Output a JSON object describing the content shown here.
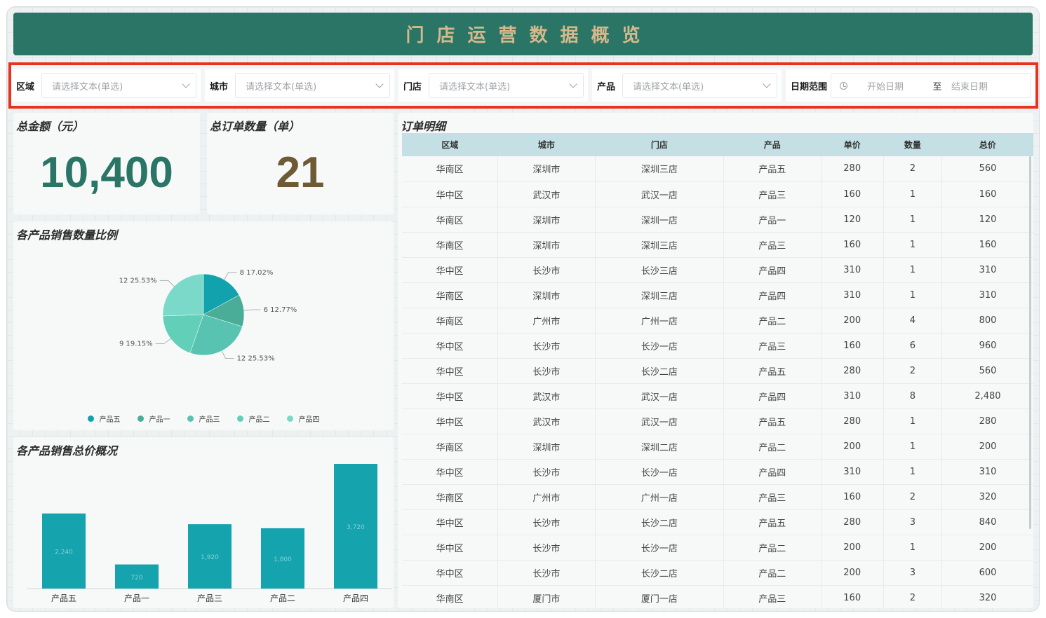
{
  "header": {
    "title": "门店运营数据概览"
  },
  "filters": [
    {
      "label": "区域",
      "placeholder": "请选择文本(单选)"
    },
    {
      "label": "城市",
      "placeholder": "请选择文本(单选)"
    },
    {
      "label": "门店",
      "placeholder": "请选择文本(单选)"
    },
    {
      "label": "产品",
      "placeholder": "请选择文本(单选)"
    }
  ],
  "date_range": {
    "label": "日期范围",
    "start_placeholder": "开始日期",
    "separator": "至",
    "end_placeholder": "结束日期"
  },
  "kpi": {
    "total_amount": {
      "title": "总金额（元）",
      "value": "10,400",
      "color": "#2a7566"
    },
    "total_orders": {
      "title": "总订单数量（单）",
      "value": "21",
      "color": "#6e5a35"
    }
  },
  "pie_card": {
    "title": "各产品销售数量比例"
  },
  "bar_card": {
    "title": "各产品销售总价概况"
  },
  "orders_card": {
    "title": "订单明细"
  },
  "orders": {
    "columns": [
      "区域",
      "城市",
      "门店",
      "产品",
      "单价",
      "数量",
      "总价"
    ],
    "rows": [
      [
        "华南区",
        "深圳市",
        "深圳三店",
        "产品五",
        "280",
        "2",
        "560"
      ],
      [
        "华中区",
        "武汉市",
        "武汉一店",
        "产品三",
        "160",
        "1",
        "160"
      ],
      [
        "华南区",
        "深圳市",
        "深圳一店",
        "产品一",
        "120",
        "1",
        "120"
      ],
      [
        "华南区",
        "深圳市",
        "深圳三店",
        "产品三",
        "160",
        "1",
        "160"
      ],
      [
        "华中区",
        "长沙市",
        "长沙三店",
        "产品四",
        "310",
        "1",
        "310"
      ],
      [
        "华南区",
        "深圳市",
        "深圳三店",
        "产品四",
        "310",
        "1",
        "310"
      ],
      [
        "华南区",
        "广州市",
        "广州一店",
        "产品二",
        "200",
        "4",
        "800"
      ],
      [
        "华中区",
        "长沙市",
        "长沙一店",
        "产品三",
        "160",
        "6",
        "960"
      ],
      [
        "华中区",
        "长沙市",
        "长沙二店",
        "产品五",
        "280",
        "2",
        "560"
      ],
      [
        "华中区",
        "武汉市",
        "武汉一店",
        "产品四",
        "310",
        "8",
        "2,480"
      ],
      [
        "华中区",
        "武汉市",
        "武汉一店",
        "产品五",
        "280",
        "1",
        "280"
      ],
      [
        "华南区",
        "深圳市",
        "深圳二店",
        "产品二",
        "200",
        "1",
        "200"
      ],
      [
        "华中区",
        "长沙市",
        "长沙一店",
        "产品四",
        "310",
        "1",
        "310"
      ],
      [
        "华南区",
        "广州市",
        "广州一店",
        "产品三",
        "160",
        "2",
        "320"
      ],
      [
        "华中区",
        "长沙市",
        "长沙二店",
        "产品五",
        "280",
        "3",
        "840"
      ],
      [
        "华中区",
        "长沙市",
        "长沙一店",
        "产品二",
        "200",
        "1",
        "200"
      ],
      [
        "华中区",
        "长沙市",
        "长沙二店",
        "产品二",
        "200",
        "3",
        "600"
      ],
      [
        "华南区",
        "厦门市",
        "厦门一店",
        "产品三",
        "160",
        "2",
        "320"
      ]
    ]
  },
  "chart_data": [
    {
      "type": "pie",
      "title": "各产品销售数量比例",
      "categories": [
        "产品五",
        "产品一",
        "产品三",
        "产品二",
        "产品四"
      ],
      "values": [
        8,
        6,
        12,
        9,
        12
      ],
      "slice_labels": [
        "8 17.02%",
        "6 12.77%",
        "12 25.53%",
        "9 19.15%",
        "12 25.53%"
      ],
      "colors": [
        "#12a2ad",
        "#4aad98",
        "#58c3b0",
        "#62cfb8",
        "#7ad9c8"
      ],
      "legend": "bottom"
    },
    {
      "type": "bar",
      "title": "各产品销售总价概况",
      "categories": [
        "产品五",
        "产品一",
        "产品三",
        "产品二",
        "产品四"
      ],
      "values": [
        2240,
        720,
        1920,
        1800,
        3720
      ],
      "value_labels": [
        "2,240",
        "720",
        "1,920",
        "1,800",
        "3,720"
      ],
      "color": "#15a3ae",
      "ylim": [
        0,
        3720
      ]
    }
  ]
}
